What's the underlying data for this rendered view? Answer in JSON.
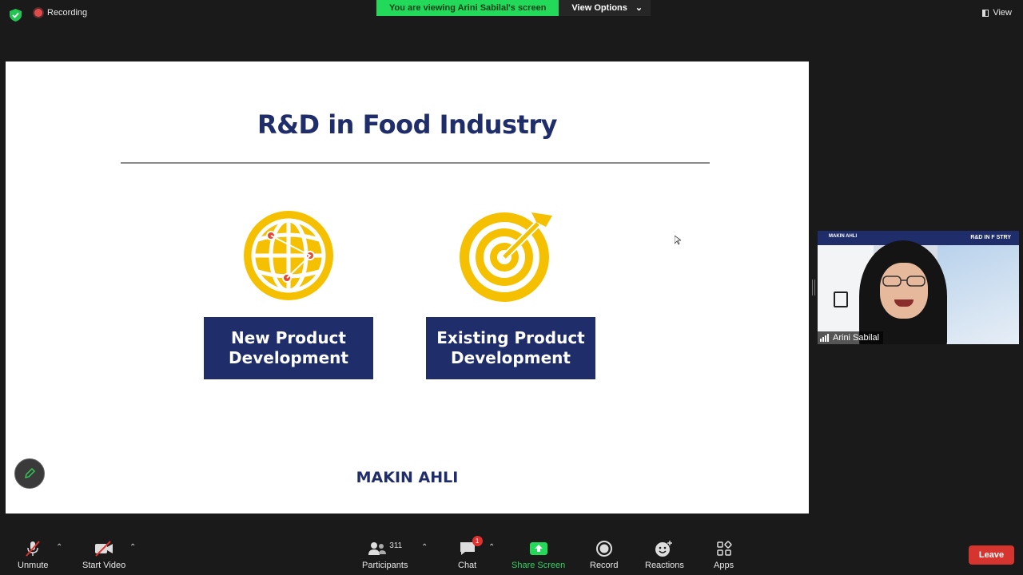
{
  "top_bar": {
    "recording_label": "Recording",
    "viewing_message": "You are viewing Arini Sabilal's screen",
    "view_options_label": "View Options",
    "view_label": "View"
  },
  "slide": {
    "title": "R&D in Food Industry",
    "box1_line1": "New Product",
    "box1_line2": "Development",
    "box2_line1": "Existing Product",
    "box2_line2": "Development",
    "footer_brand": "MAKIN AHLI",
    "accent_color": "#1f2d6b",
    "icon_color": "#f5c000",
    "icons": [
      "globe-network-icon",
      "target-icon"
    ]
  },
  "webcam": {
    "participant_name": "Arini Sabilal",
    "band_left_text": "MAKIN AHLI",
    "band_right_text": "R&D IN F     STRY"
  },
  "toolbar": {
    "unmute_label": "Unmute",
    "start_video_label": "Start Video",
    "participants_label": "Participants",
    "participants_count": "311",
    "chat_label": "Chat",
    "chat_badge": "1",
    "share_screen_label": "Share Screen",
    "record_label": "Record",
    "reactions_label": "Reactions",
    "apps_label": "Apps",
    "leave_label": "Leave"
  }
}
